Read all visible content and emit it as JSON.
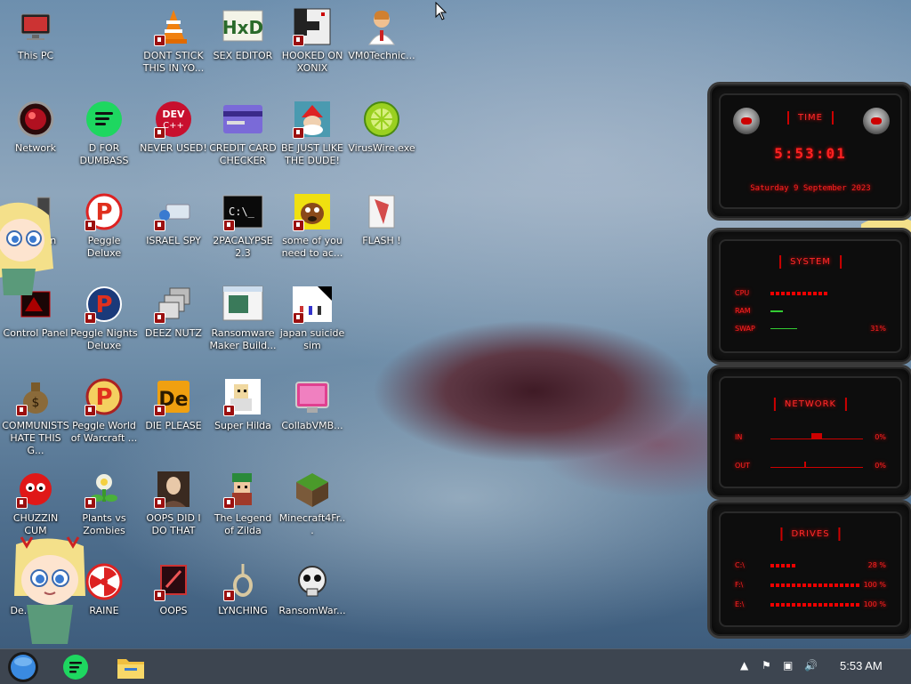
{
  "desktop_icons": [
    {
      "label": "This PC",
      "icon": "monitor-icon"
    },
    {
      "label": "DONT STICK THIS IN YO...",
      "icon": "vlc-cone-icon"
    },
    {
      "label": "SEX EDITOR",
      "icon": "hxd-icon"
    },
    {
      "label": "HOOKED ON XONIX",
      "icon": "xonix-icon"
    },
    {
      "label": "VM0Technic...",
      "icon": "doctor-icon"
    },
    {
      "label": "Network",
      "icon": "network-icon"
    },
    {
      "label": "D FOR DUMBASS",
      "icon": "discord-like-icon"
    },
    {
      "label": "NEVER USED!",
      "icon": "devcpp-icon"
    },
    {
      "label": "CREDIT CARD CHECKER",
      "icon": "credit-card-icon"
    },
    {
      "label": "BE JUST LIKE THE DUDE!",
      "icon": "santa-icon"
    },
    {
      "label": "VirusWire.exe",
      "icon": "limewire-icon"
    },
    {
      "label": "Bin",
      "icon": "recycle-bin-icon"
    },
    {
      "label": "Peggle Deluxe",
      "icon": "peggle-icon"
    },
    {
      "label": "ISRAEL SPY",
      "icon": "spy-icon"
    },
    {
      "label": "2PACALYPSE 2.3",
      "icon": "terminal-icon"
    },
    {
      "label": "some of you need to ac...",
      "icon": "dog-icon"
    },
    {
      "label": "FLASH !",
      "icon": "flash-icon"
    },
    {
      "label": "Control Panel",
      "icon": "control-panel-icon"
    },
    {
      "label": "Peggle Nights Deluxe",
      "icon": "peggle-nights-icon"
    },
    {
      "label": "DEEZ NUTZ",
      "icon": "windows-stack-icon"
    },
    {
      "label": "Ransomware Maker Build...",
      "icon": "ransomware-maker-icon"
    },
    {
      "label": "japan suicide sim",
      "icon": "japan-sim-icon"
    },
    {
      "label": "COMMUNISTS HATE THIS G...",
      "icon": "money-bag-icon"
    },
    {
      "label": "Peggle World of Warcraft ...",
      "icon": "peggle-wow-icon"
    },
    {
      "label": "DIE PLEASE",
      "icon": "de-icon"
    },
    {
      "label": "Super Hilda",
      "icon": "hilda-icon"
    },
    {
      "label": "CollabVMB...",
      "icon": "collabvm-icon"
    },
    {
      "label": "CHUZZIN CUM",
      "icon": "chuzzle-icon"
    },
    {
      "label": "Plants vs Zombies",
      "icon": "pvz-icon"
    },
    {
      "label": "OOPS DID I DO THAT",
      "icon": "portrait-icon"
    },
    {
      "label": "The Legend of Zilda",
      "icon": "zelda-icon"
    },
    {
      "label": "Minecraft4Fr...",
      "icon": "minecraft-icon"
    },
    {
      "label": "De... Bla...",
      "icon": "unknown-icon"
    },
    {
      "label": "RAINE",
      "icon": "radiation-icon"
    },
    {
      "label": "OOPS",
      "icon": "oops-icon"
    },
    {
      "label": "LYNCHING",
      "icon": "noose-icon"
    },
    {
      "label": "RansomWar...",
      "icon": "skull-icon"
    }
  ],
  "widget": {
    "time_title": "TIME",
    "time": "5:53:01",
    "date": "Saturday 9 September 2023",
    "system_title": "SYSTEM",
    "cpu_label": "CPU",
    "ram_label": "RAM",
    "swap_label": "SWAP",
    "swap_value": "31%",
    "network_title": "NETWORK",
    "in_label": "IN",
    "in_value": "0%",
    "out_label": "OUT",
    "out_value": "0%",
    "drives_title": "DRIVES",
    "drives": [
      {
        "label": "C:\\",
        "value": "28 %",
        "fill": 0.28
      },
      {
        "label": "F:\\",
        "value": "100 %",
        "fill": 1.0
      },
      {
        "label": "E:\\",
        "value": "100 %",
        "fill": 1.0
      }
    ],
    "accent": "#ff2222"
  },
  "taskbar": {
    "clock": "5:53 AM",
    "start_icon": "start-orb-icon",
    "pinned": [
      "green-chat-icon",
      "file-explorer-icon"
    ],
    "tray": [
      "chevron-up-icon",
      "flag-icon",
      "network-tray-icon",
      "volume-icon"
    ]
  }
}
